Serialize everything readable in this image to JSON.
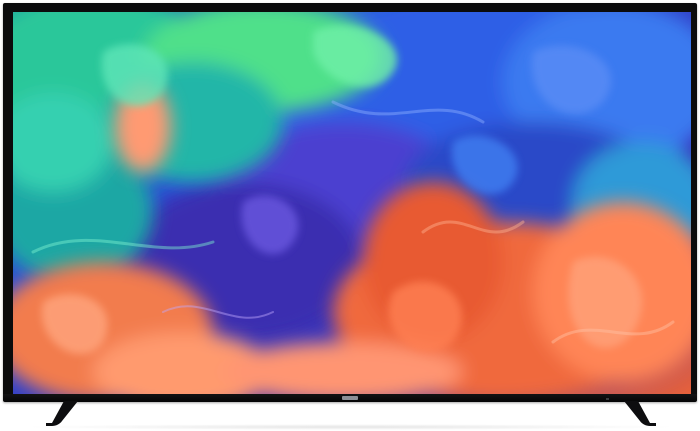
{
  "image": {
    "subject": "flat-screen-tv",
    "screen_art": "colorful-smoke-wallpaper",
    "colors": {
      "bezel": "#0b0b0c",
      "screen_green": "#2fd08a",
      "screen_teal": "#26b8b0",
      "screen_blue": "#2f59e0",
      "screen_purple": "#5a3fc8",
      "screen_orange": "#f26a3c",
      "screen_coral": "#ff8a5c",
      "stand": "#0d0d0f"
    }
  }
}
